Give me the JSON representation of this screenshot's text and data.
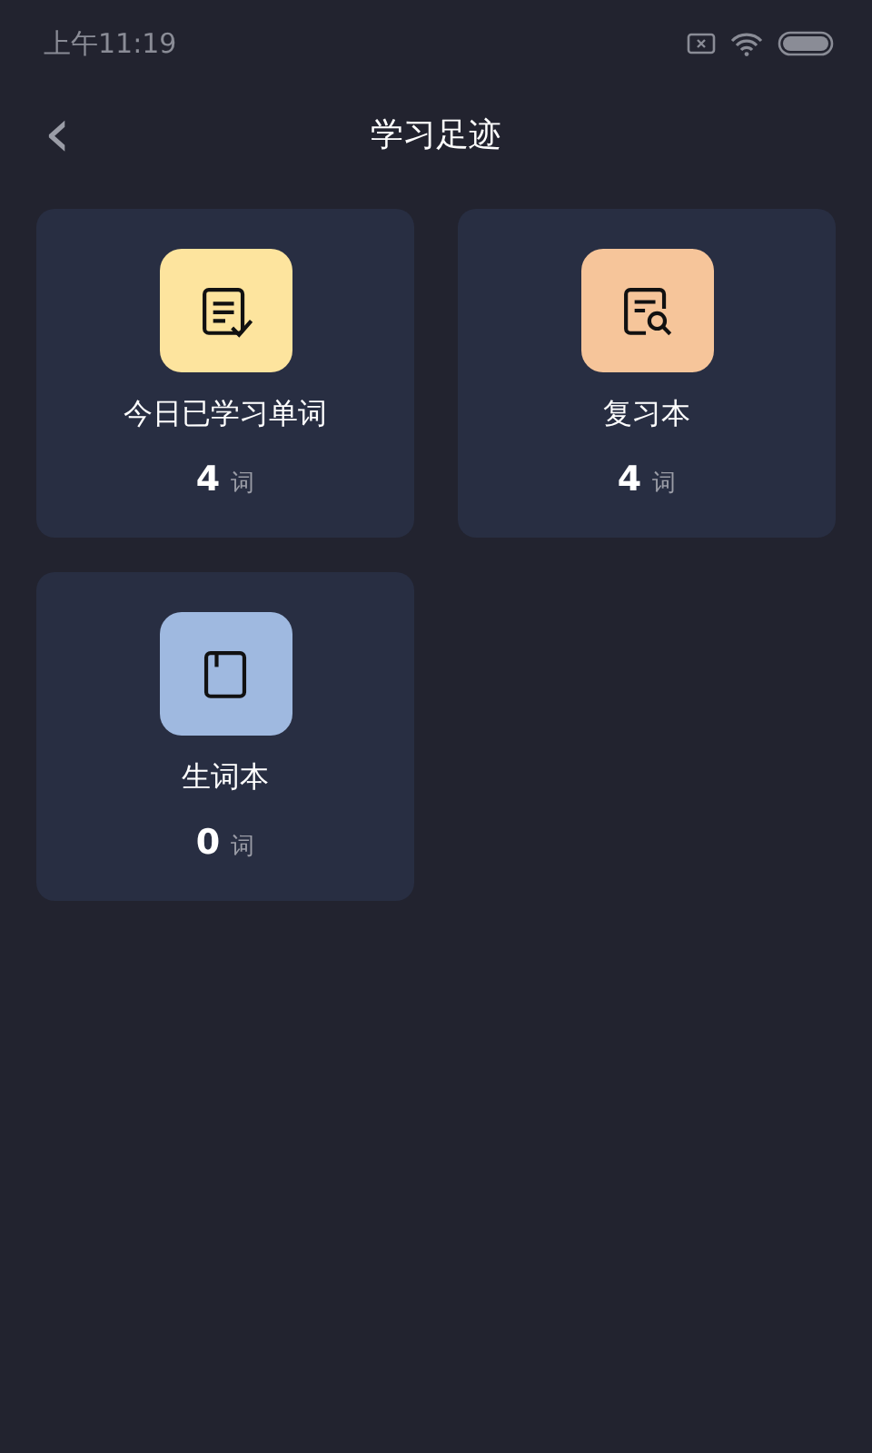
{
  "status_bar": {
    "time": "上午11:19"
  },
  "header": {
    "back": "‹",
    "title": "学习足迹"
  },
  "cards": [
    {
      "kind": "checklist",
      "color": "#fde49e",
      "label": "今日已学习单词",
      "count": "4",
      "unit": "词"
    },
    {
      "kind": "search",
      "color": "#f6c59a",
      "label": "复习本",
      "count": "4",
      "unit": "词"
    },
    {
      "kind": "book",
      "color": "#9fb9e0",
      "label": "生词本",
      "count": "0",
      "unit": "词"
    }
  ]
}
